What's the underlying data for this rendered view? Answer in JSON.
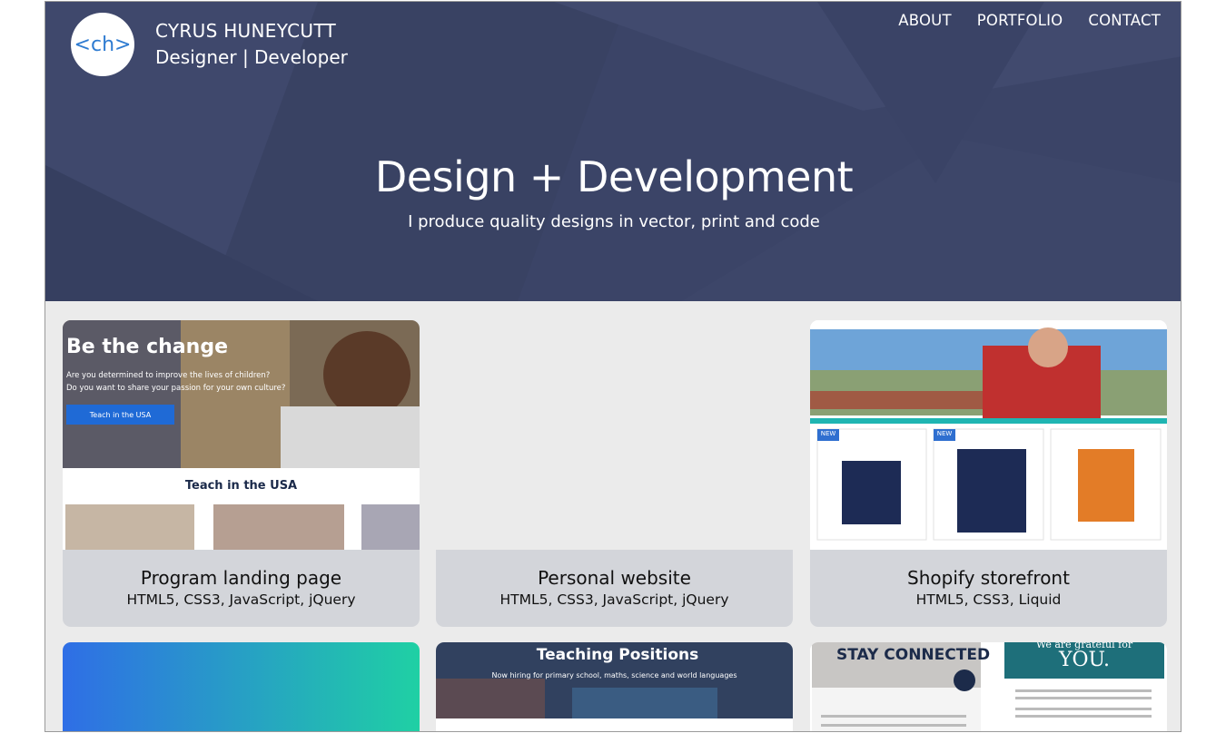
{
  "header": {
    "logo_text": "<ch>",
    "name": "CYRUS HUNEYCUTT",
    "role": "Designer | Developer",
    "nav": [
      "ABOUT",
      "PORTFOLIO",
      "CONTACT"
    ]
  },
  "hero": {
    "title": "Design + Development",
    "subtitle": "I produce quality designs in vector, print and code"
  },
  "projects": [
    {
      "title": "Program landing page",
      "tech": "HTML5, CSS3, JavaScript, jQuery",
      "thumb": {
        "heading": "Be the change",
        "line1": "Are you determined to improve the lives of children?",
        "line2": "Do you want to share your passion for your own culture?",
        "button": "Teach in the USA",
        "section_title": "Teach in the USA"
      }
    },
    {
      "title": "Personal website",
      "tech": "HTML5, CSS3, JavaScript, jQuery"
    },
    {
      "title": "Shopify storefront",
      "tech": "HTML5, CSS3, Liquid",
      "thumb": {
        "badge1": "NEW",
        "badge2": "NEW"
      }
    }
  ],
  "row2": {
    "teaching_title": "Teaching Positions",
    "teaching_sub": "Now hiring for primary school, maths, science and world languages",
    "stay_connected": "STAY CONNECTED",
    "we_are_grateful": "We are grateful for",
    "you": "YOU."
  },
  "colors": {
    "hero_bg": "#3b4467",
    "caption_bg": "#d3d5da",
    "page_bg": "#ebebeb",
    "accent_blue": "#2e7bd1"
  }
}
